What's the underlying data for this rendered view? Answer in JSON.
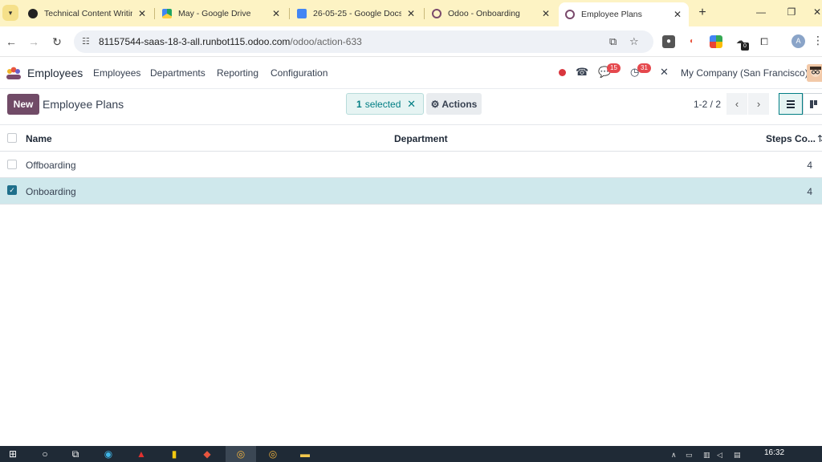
{
  "browser": {
    "tabs": [
      {
        "title": "Technical Content Writing",
        "favicon_color": "#222222"
      },
      {
        "title": "May - Google Drive",
        "favicon_color": "#1fa463"
      },
      {
        "title": "26-05-25 - Google Docs",
        "favicon_color": "#4285f4"
      },
      {
        "title": "Odoo - Onboarding",
        "favicon_color": "#7a4a6c"
      },
      {
        "title": "Employee Plans",
        "favicon_color": "#7a4a6c"
      }
    ],
    "new_tab": "+",
    "url_host": "81157544-saas-18-3-all.runbot115.odoo.com",
    "url_path": "/odoo/action-633",
    "profile_initial": "A",
    "extension_badge": "0"
  },
  "odoo": {
    "app_name": "Employees",
    "menu": [
      "Employees",
      "Departments",
      "Reporting",
      "Configuration"
    ],
    "messages_badge": "15",
    "activities_badge": "31",
    "company": "My Company (San Francisco)"
  },
  "control": {
    "new_label": "New",
    "title": "Employee Plans",
    "selected_count": "1",
    "selected_label": "selected",
    "actions_label": "Actions",
    "pager": "1-2 / 2"
  },
  "list": {
    "columns": {
      "name": "Name",
      "department": "Department",
      "steps": "Steps Co..."
    },
    "rows": [
      {
        "name": "Offboarding",
        "department": "",
        "steps": "4",
        "selected": false
      },
      {
        "name": "Onboarding",
        "department": "",
        "steps": "4",
        "selected": true
      }
    ]
  },
  "taskbar": {
    "clock": "16:32"
  }
}
